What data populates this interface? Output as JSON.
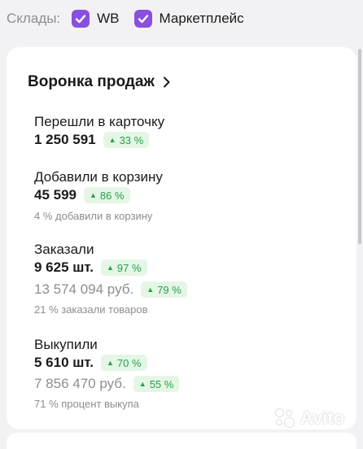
{
  "filters": {
    "label": "Склады:",
    "options": [
      {
        "label": "WB",
        "checked": true
      },
      {
        "label": "Маркетплейс",
        "checked": true
      }
    ]
  },
  "funnel": {
    "title": "Воронка продаж",
    "sections": [
      {
        "label": "Перешли в карточку",
        "value": "1 250 591",
        "change": "33 %"
      },
      {
        "label": "Добавили в корзину",
        "value": "45 599",
        "change": "86 %",
        "note": "4 % добавили в корзину"
      },
      {
        "label": "Заказали",
        "value": "9 625 шт.",
        "change": "97 %",
        "sum": "13 574 094 руб.",
        "sum_change": "79 %",
        "note": "21 % заказали товаров"
      },
      {
        "label": "Выкупили",
        "value": "5 610 шт.",
        "change": "70 %",
        "sum": "7 856 470 руб.",
        "sum_change": "55 %",
        "note": "71 % процент выкупа"
      }
    ]
  },
  "watermark": "Avito",
  "colors": {
    "accent": "#8a4fe0",
    "badge_bg": "#e6f6e6",
    "badge_text": "#24a148"
  },
  "icons": {
    "checkbox": "checkmark-icon",
    "chevron": "chevron-right-icon",
    "trend": "triangle-up-icon"
  }
}
